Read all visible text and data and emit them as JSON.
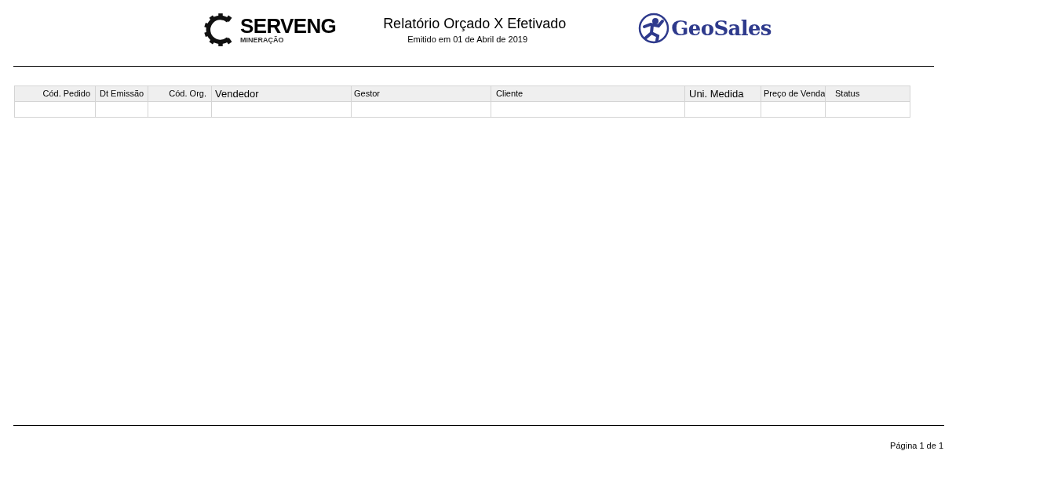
{
  "header": {
    "company_logo": {
      "name": "SERVENG",
      "subtitle": "MINERAÇÃO"
    },
    "title": "Relatório Orçado X Efetivado",
    "subtitle": "Emitido em 01 de Abril de 2019",
    "product_logo": {
      "name": "GeoSales"
    }
  },
  "table": {
    "columns": [
      "Cód. Pedido",
      "Dt Emissão",
      "Cód. Org.",
      "Vendedor",
      "Gestor",
      "Cliente",
      "Uni. Medida",
      "Preço de Venda",
      "Status"
    ]
  },
  "footer": {
    "page": "Página 1 de 1"
  }
}
